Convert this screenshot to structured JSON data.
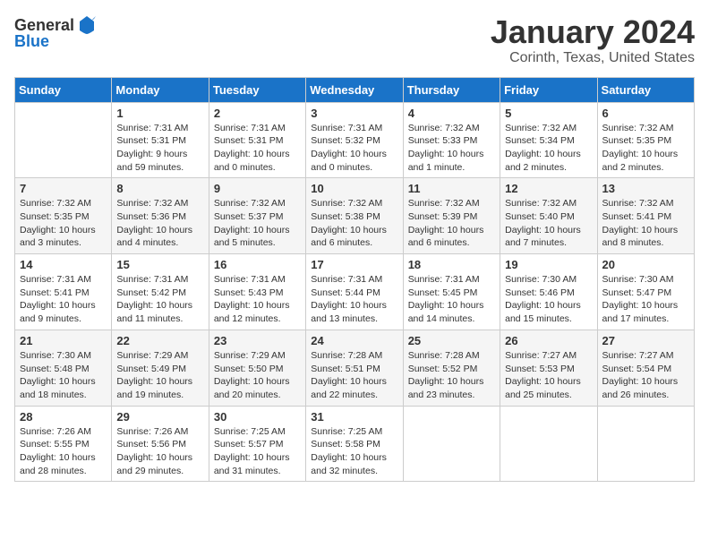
{
  "logo": {
    "general": "General",
    "blue": "Blue"
  },
  "header": {
    "month": "January 2024",
    "location": "Corinth, Texas, United States"
  },
  "weekdays": [
    "Sunday",
    "Monday",
    "Tuesday",
    "Wednesday",
    "Thursday",
    "Friday",
    "Saturday"
  ],
  "weeks": [
    [
      {
        "day": "",
        "info": ""
      },
      {
        "day": "1",
        "info": "Sunrise: 7:31 AM\nSunset: 5:31 PM\nDaylight: 9 hours\nand 59 minutes."
      },
      {
        "day": "2",
        "info": "Sunrise: 7:31 AM\nSunset: 5:31 PM\nDaylight: 10 hours\nand 0 minutes."
      },
      {
        "day": "3",
        "info": "Sunrise: 7:31 AM\nSunset: 5:32 PM\nDaylight: 10 hours\nand 0 minutes."
      },
      {
        "day": "4",
        "info": "Sunrise: 7:32 AM\nSunset: 5:33 PM\nDaylight: 10 hours\nand 1 minute."
      },
      {
        "day": "5",
        "info": "Sunrise: 7:32 AM\nSunset: 5:34 PM\nDaylight: 10 hours\nand 2 minutes."
      },
      {
        "day": "6",
        "info": "Sunrise: 7:32 AM\nSunset: 5:35 PM\nDaylight: 10 hours\nand 2 minutes."
      }
    ],
    [
      {
        "day": "7",
        "info": "Sunrise: 7:32 AM\nSunset: 5:35 PM\nDaylight: 10 hours\nand 3 minutes."
      },
      {
        "day": "8",
        "info": "Sunrise: 7:32 AM\nSunset: 5:36 PM\nDaylight: 10 hours\nand 4 minutes."
      },
      {
        "day": "9",
        "info": "Sunrise: 7:32 AM\nSunset: 5:37 PM\nDaylight: 10 hours\nand 5 minutes."
      },
      {
        "day": "10",
        "info": "Sunrise: 7:32 AM\nSunset: 5:38 PM\nDaylight: 10 hours\nand 6 minutes."
      },
      {
        "day": "11",
        "info": "Sunrise: 7:32 AM\nSunset: 5:39 PM\nDaylight: 10 hours\nand 6 minutes."
      },
      {
        "day": "12",
        "info": "Sunrise: 7:32 AM\nSunset: 5:40 PM\nDaylight: 10 hours\nand 7 minutes."
      },
      {
        "day": "13",
        "info": "Sunrise: 7:32 AM\nSunset: 5:41 PM\nDaylight: 10 hours\nand 8 minutes."
      }
    ],
    [
      {
        "day": "14",
        "info": "Sunrise: 7:31 AM\nSunset: 5:41 PM\nDaylight: 10 hours\nand 9 minutes."
      },
      {
        "day": "15",
        "info": "Sunrise: 7:31 AM\nSunset: 5:42 PM\nDaylight: 10 hours\nand 11 minutes."
      },
      {
        "day": "16",
        "info": "Sunrise: 7:31 AM\nSunset: 5:43 PM\nDaylight: 10 hours\nand 12 minutes."
      },
      {
        "day": "17",
        "info": "Sunrise: 7:31 AM\nSunset: 5:44 PM\nDaylight: 10 hours\nand 13 minutes."
      },
      {
        "day": "18",
        "info": "Sunrise: 7:31 AM\nSunset: 5:45 PM\nDaylight: 10 hours\nand 14 minutes."
      },
      {
        "day": "19",
        "info": "Sunrise: 7:30 AM\nSunset: 5:46 PM\nDaylight: 10 hours\nand 15 minutes."
      },
      {
        "day": "20",
        "info": "Sunrise: 7:30 AM\nSunset: 5:47 PM\nDaylight: 10 hours\nand 17 minutes."
      }
    ],
    [
      {
        "day": "21",
        "info": "Sunrise: 7:30 AM\nSunset: 5:48 PM\nDaylight: 10 hours\nand 18 minutes."
      },
      {
        "day": "22",
        "info": "Sunrise: 7:29 AM\nSunset: 5:49 PM\nDaylight: 10 hours\nand 19 minutes."
      },
      {
        "day": "23",
        "info": "Sunrise: 7:29 AM\nSunset: 5:50 PM\nDaylight: 10 hours\nand 20 minutes."
      },
      {
        "day": "24",
        "info": "Sunrise: 7:28 AM\nSunset: 5:51 PM\nDaylight: 10 hours\nand 22 minutes."
      },
      {
        "day": "25",
        "info": "Sunrise: 7:28 AM\nSunset: 5:52 PM\nDaylight: 10 hours\nand 23 minutes."
      },
      {
        "day": "26",
        "info": "Sunrise: 7:27 AM\nSunset: 5:53 PM\nDaylight: 10 hours\nand 25 minutes."
      },
      {
        "day": "27",
        "info": "Sunrise: 7:27 AM\nSunset: 5:54 PM\nDaylight: 10 hours\nand 26 minutes."
      }
    ],
    [
      {
        "day": "28",
        "info": "Sunrise: 7:26 AM\nSunset: 5:55 PM\nDaylight: 10 hours\nand 28 minutes."
      },
      {
        "day": "29",
        "info": "Sunrise: 7:26 AM\nSunset: 5:56 PM\nDaylight: 10 hours\nand 29 minutes."
      },
      {
        "day": "30",
        "info": "Sunrise: 7:25 AM\nSunset: 5:57 PM\nDaylight: 10 hours\nand 31 minutes."
      },
      {
        "day": "31",
        "info": "Sunrise: 7:25 AM\nSunset: 5:58 PM\nDaylight: 10 hours\nand 32 minutes."
      },
      {
        "day": "",
        "info": ""
      },
      {
        "day": "",
        "info": ""
      },
      {
        "day": "",
        "info": ""
      }
    ]
  ]
}
